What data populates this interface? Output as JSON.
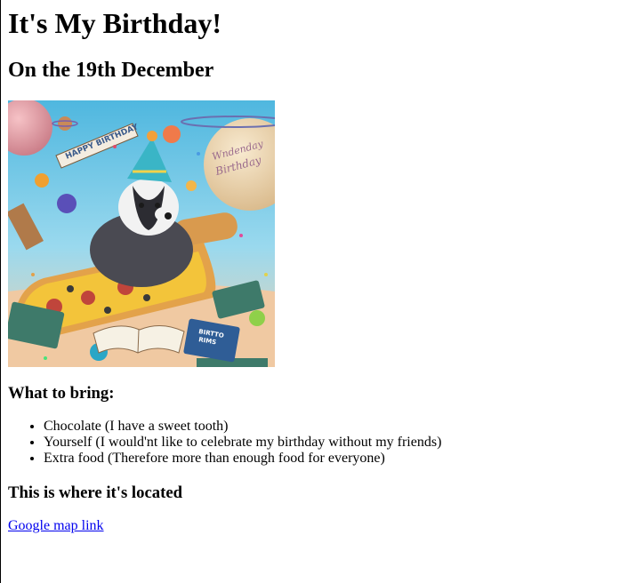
{
  "page": {
    "title": "It's My Birthday!",
    "date_heading": "On the 19th December"
  },
  "image": {
    "banner_text": "HAPPY BIRTHDAY",
    "planet_text_line1": "Wndenday",
    "planet_text_line2": "Birthday",
    "book_text_line1": "BIRTTO",
    "book_text_line2": "RIMS",
    "colors": {
      "sky_top": "#5fc8e6",
      "sky_bottom": "#8fd6ec",
      "floor": "#efc9a0",
      "pizza_crust": "#e3a24a",
      "pizza_cheese": "#f3c43a",
      "pepperoni": "#c0453b",
      "party_hat": "#3ab5c6",
      "badger_fur": "#4a4a52",
      "book_green": "#3e7a6a",
      "book_blue": "#2f5d96"
    }
  },
  "bring": {
    "heading": "What to bring:",
    "items": [
      "Chocolate (I have a sweet tooth)",
      "Yourself (I would'nt like to celebrate my birthday without my friends)",
      "Extra food (Therefore more than enough food for everyone)"
    ]
  },
  "location": {
    "heading": "This is where it's located",
    "link_text": "Google map link"
  }
}
